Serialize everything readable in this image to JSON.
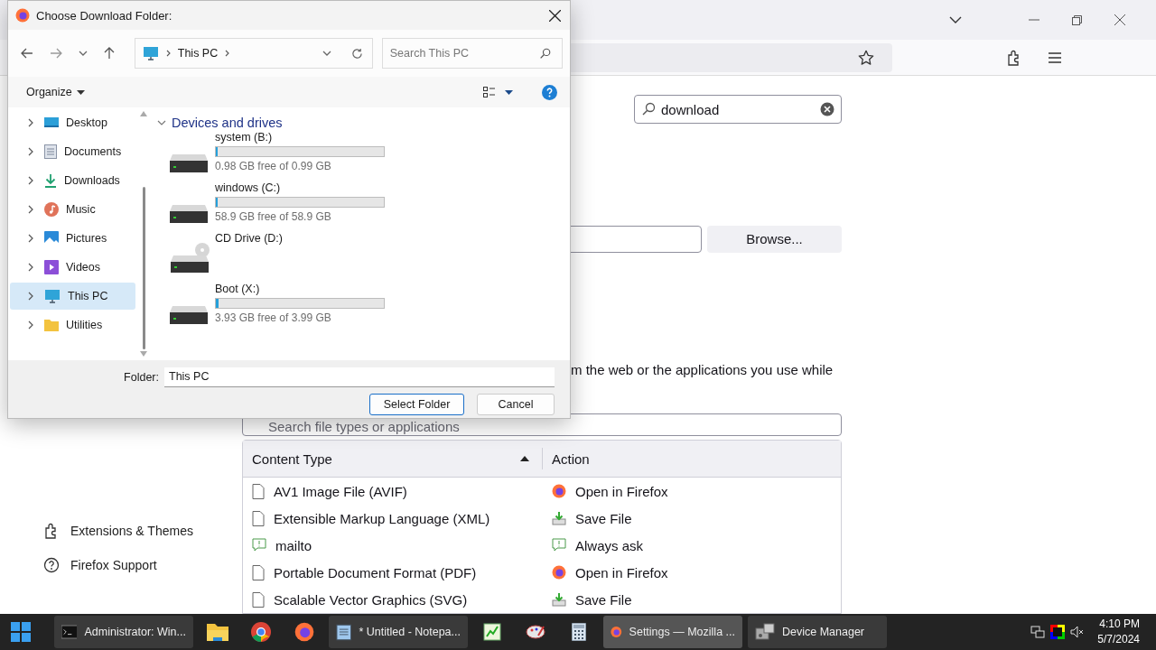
{
  "browser": {
    "search": {
      "value": "download"
    },
    "browse_button": "Browse...",
    "description": "m the web or the applications you use while",
    "filter": {
      "placeholder": "Search file types or applications"
    },
    "sidebar": {
      "items": [
        {
          "label": "Extensions & Themes",
          "kind": "puzzle"
        },
        {
          "label": "Firefox Support",
          "kind": "help"
        }
      ]
    },
    "table": {
      "columns": [
        {
          "label": "Content Type",
          "sorted": true
        },
        {
          "label": "Action",
          "sorted": false
        }
      ],
      "rows": [
        {
          "content_type": {
            "text": "AV1 Image File (AVIF)",
            "kind": "file"
          },
          "action": {
            "text": "Open in Firefox",
            "kind": "firefox"
          }
        },
        {
          "content_type": {
            "text": "Extensible Markup Language (XML)",
            "kind": "file"
          },
          "action": {
            "text": "Save File",
            "kind": "save"
          }
        },
        {
          "content_type": {
            "text": "mailto",
            "kind": "ask"
          },
          "action": {
            "text": "Always ask",
            "kind": "ask"
          }
        },
        {
          "content_type": {
            "text": "Portable Document Format (PDF)",
            "kind": "file"
          },
          "action": {
            "text": "Open in Firefox",
            "kind": "firefox"
          }
        },
        {
          "content_type": {
            "text": "Scalable Vector Graphics (SVG)",
            "kind": "file"
          },
          "action": {
            "text": "Save File",
            "kind": "save"
          }
        }
      ]
    }
  },
  "dialog": {
    "title": "Choose Download Folder:",
    "breadcrumb": "This PC",
    "search": {
      "placeholder": "Search This PC"
    },
    "organize": "Organize",
    "nav": [
      {
        "label": "Desktop",
        "kind": "desktop",
        "selected": false
      },
      {
        "label": "Documents",
        "kind": "documents",
        "selected": false
      },
      {
        "label": "Downloads",
        "kind": "downloads",
        "selected": false
      },
      {
        "label": "Music",
        "kind": "music",
        "selected": false
      },
      {
        "label": "Pictures",
        "kind": "pictures",
        "selected": false
      },
      {
        "label": "Videos",
        "kind": "videos",
        "selected": false
      },
      {
        "label": "This PC",
        "kind": "pc",
        "selected": true
      },
      {
        "label": "Utilities",
        "kind": "folder",
        "selected": false
      }
    ],
    "group": {
      "title": "Devices and drives",
      "expanded": true
    },
    "drives": [
      {
        "name": "system (B:)",
        "kind": "disk",
        "level": 0.01,
        "free": "0.98 GB free of 0.99 GB"
      },
      {
        "name": "windows (C:)",
        "kind": "disk",
        "level": 0,
        "free": "58.9 GB free of 58.9 GB"
      },
      {
        "name": "CD Drive (D:)",
        "kind": "cd"
      },
      {
        "name": "Boot (X:)",
        "kind": "disk",
        "level": 0.015,
        "free": "3.93 GB free of 3.99 GB"
      }
    ],
    "folder_label": "Folder:",
    "folder_value": "This PC",
    "buttons": [
      {
        "label": "Select Folder",
        "kind": "primary"
      },
      {
        "label": "Cancel",
        "kind": "secondary"
      }
    ]
  },
  "taskbar": {
    "items": [
      {
        "label": "Administrator: Win...",
        "kind": "terminal",
        "selected": false
      },
      {
        "kind": "folder",
        "selected": false
      },
      {
        "kind": "chrome",
        "selected": false
      },
      {
        "kind": "firefox",
        "selected": false
      },
      {
        "label": "* Untitled - Notepa...",
        "kind": "notepad",
        "selected": false
      },
      {
        "kind": "editor",
        "selected": false
      },
      {
        "kind": "paint",
        "selected": false
      },
      {
        "kind": "calculator",
        "selected": false
      },
      {
        "label": "Settings — Mozilla ...",
        "kind": "firefox",
        "selected": true
      },
      {
        "label": "Device Manager",
        "kind": "devices",
        "selected": false
      }
    ],
    "time": "4:10 PM",
    "date": "5/7/2024"
  }
}
